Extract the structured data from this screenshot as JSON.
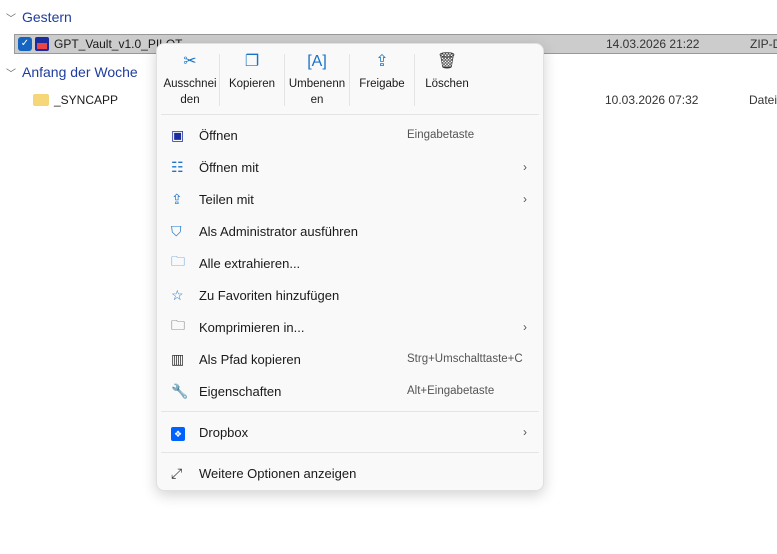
{
  "groups": [
    {
      "label": "Gestern",
      "files": [
        {
          "name": "GPT_Vault_v1.0_PILOT",
          "date": "14.03.2026 21:22",
          "type": "ZIP-D"
        }
      ]
    },
    {
      "label": "Anfang der Woche",
      "files": [
        {
          "name": "_SYNCAPP",
          "date": "10.03.2026 07:32",
          "type": "Datei"
        }
      ]
    }
  ],
  "menu": {
    "toolbar": [
      {
        "label": "Ausschnei den",
        "icon": "scissors-icon"
      },
      {
        "label": "Kopieren",
        "icon": "copy-icon"
      },
      {
        "label": "Umbenenn en",
        "icon": "rename-icon"
      },
      {
        "label": "Freigabe",
        "icon": "share-icon"
      },
      {
        "label": "Löschen",
        "icon": "trash-icon"
      }
    ],
    "items": [
      {
        "label": "Öffnen",
        "shortcut": "Eingabetaste"
      },
      {
        "label": "Öffnen mit",
        "arrow": "›"
      },
      {
        "label": "Teilen mit",
        "arrow": "›"
      },
      {
        "label": "Als Administrator ausführen"
      },
      {
        "label": "Alle extrahieren..."
      },
      {
        "label": "Zu Favoriten hinzufügen"
      },
      {
        "label": "Komprimieren in...",
        "arrow": "›"
      },
      {
        "label": "Als Pfad kopieren",
        "shortcut": "Strg+Umschalttaste+C"
      },
      {
        "label": "Eigenschaften",
        "shortcut": "Alt+Eingabetaste"
      },
      {
        "label": "Dropbox",
        "arrow": "›"
      },
      {
        "label": "Weitere Optionen anzeigen"
      }
    ]
  }
}
